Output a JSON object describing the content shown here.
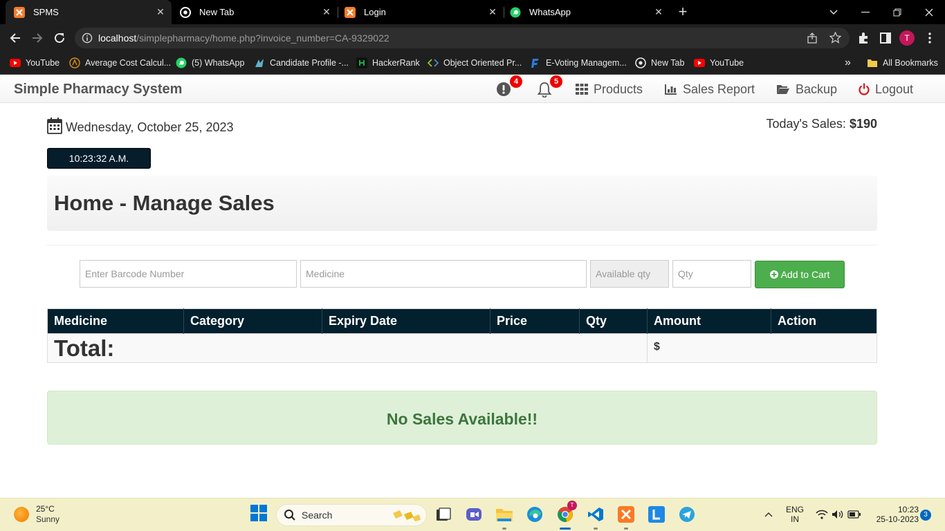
{
  "browser": {
    "tabs": [
      {
        "title": "SPMS",
        "icon": "xampp-icon",
        "active": true
      },
      {
        "title": "New Tab",
        "icon": "chrome-icon",
        "active": false
      },
      {
        "title": "Login",
        "icon": "xampp-icon",
        "active": false
      },
      {
        "title": "WhatsApp",
        "icon": "whatsapp-icon",
        "active": false
      }
    ],
    "url_host": "localhost",
    "url_path": "/simplepharmacy/home.php?invoice_number=CA-9329022",
    "profile_initial": "T",
    "bookmarks": [
      {
        "label": "YouTube",
        "icon": "youtube-icon"
      },
      {
        "label": "Average Cost Calcul...",
        "icon": "calculator-icon"
      },
      {
        "label": "(5) WhatsApp",
        "icon": "whatsapp-icon"
      },
      {
        "label": "Candidate Profile -...",
        "icon": "profile-icon"
      },
      {
        "label": "HackerRank",
        "icon": "hackerrank-icon"
      },
      {
        "label": "Object Oriented Pr...",
        "icon": "code-icon"
      },
      {
        "label": "E-Voting Managem...",
        "icon": "evoting-icon"
      },
      {
        "label": "New Tab",
        "icon": "chrome-icon"
      },
      {
        "label": "YouTube",
        "icon": "youtube-icon"
      }
    ],
    "all_bookmarks": "All Bookmarks",
    "more_bookmarks": "»"
  },
  "app": {
    "brand": "Simple Pharmacy System",
    "alerts_count": "4",
    "notifications_count": "5",
    "nav": {
      "products": "Products",
      "sales_report": "Sales Report",
      "backup": "Backup",
      "logout": "Logout"
    },
    "date": "Wednesday, October 25, 2023",
    "today_sales_label": "Today's Sales:",
    "today_sales_value": "$190",
    "clock": "10:23:32 A.M.",
    "page_title": "Home - Manage Sales",
    "form": {
      "barcode_placeholder": "Enter Barcode Number",
      "medicine_placeholder": "Medicine",
      "available_qty_placeholder": "Available qty",
      "qty_placeholder": "Qty",
      "add_to_cart": "Add to Cart"
    },
    "table": {
      "headers": [
        "Medicine",
        "Category",
        "Expiry Date",
        "Price",
        "Qty",
        "Amount",
        "Action"
      ],
      "total_label": "Total:",
      "total_amount": "$"
    },
    "empty_message": "No Sales Available!!"
  },
  "taskbar": {
    "temperature": "25°C",
    "condition": "Sunny",
    "search": "Search",
    "language_1": "ENG",
    "language_2": "IN",
    "time": "10:23",
    "date": "25-10-2023",
    "notification_count": "3"
  }
}
